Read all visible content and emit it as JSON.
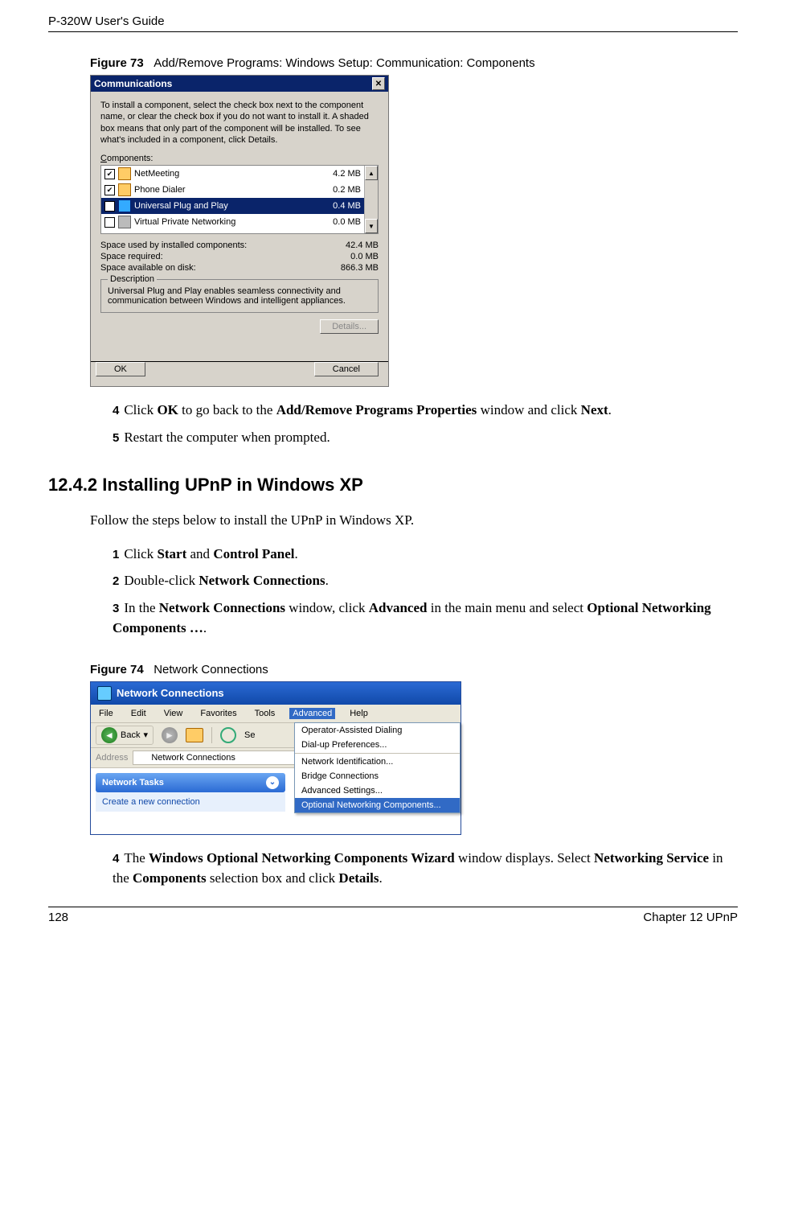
{
  "header": {
    "left": "P-320W User's Guide"
  },
  "figure73": {
    "label": "Figure 73",
    "title": "Add/Remove Programs: Windows Setup: Communication: Components"
  },
  "comm_dialog": {
    "title": "Communications",
    "intro": "To install a component, select the check box next to the component name, or clear the check box if you do not want to install it. A shaded box means that only part of the component will be installed. To see what's included in a component, click Details.",
    "components_label_pre": "C",
    "components_label_post": "omponents:",
    "rows": [
      {
        "checked": true,
        "name": "NetMeeting",
        "size": "4.2 MB",
        "selected": false
      },
      {
        "checked": true,
        "name": "Phone Dialer",
        "size": "0.2 MB",
        "selected": false
      },
      {
        "checked": true,
        "name": "Universal Plug and Play",
        "size": "0.4 MB",
        "selected": true
      },
      {
        "checked": false,
        "name": "Virtual Private Networking",
        "size": "0.0 MB",
        "selected": false
      }
    ],
    "stats": {
      "used_label": "Space used by installed components:",
      "used_val": "42.4 MB",
      "req_label": "Space required:",
      "req_val": "0.0 MB",
      "avail_label": "Space available on disk:",
      "avail_val": "866.3 MB"
    },
    "group_legend": "Description",
    "description": "Universal Plug and Play enables seamless connectivity and communication between Windows and intelligent appliances.",
    "details_btn": "Details...",
    "ok_btn": "OK",
    "cancel_btn": "Cancel"
  },
  "steps_a": {
    "s4_pre": "Click ",
    "s4_b1": "OK",
    "s4_mid": " to go back to the ",
    "s4_b2": "Add/Remove Programs Properties",
    "s4_mid2": " window and click ",
    "s4_b3": "Next",
    "s4_post": ".",
    "s5": "Restart the computer when prompted."
  },
  "section_heading": "12.4.2  Installing UPnP in Windows XP",
  "section_intro": "Follow the steps below to install the UPnP in Windows XP.",
  "steps_b": {
    "s1_pre": "Click ",
    "s1_b1": "Start",
    "s1_mid": " and ",
    "s1_b2": "Control Panel",
    "s1_post": ".",
    "s2_pre": "Double-click ",
    "s2_b1": "Network Connections",
    "s2_post": ".",
    "s3_pre": "In the ",
    "s3_b1": "Network Connections",
    "s3_mid1": " window, click ",
    "s3_b2": "Advanced",
    "s3_mid2": " in the main menu and select ",
    "s3_b3": "Optional Networking Components …",
    "s3_post": "."
  },
  "figure74": {
    "label": "Figure 74",
    "title": "Network Connections"
  },
  "xp": {
    "title": "Network Connections",
    "menus": [
      "File",
      "Edit",
      "View",
      "Favorites",
      "Tools",
      "Advanced",
      "Help"
    ],
    "back_label": "Back",
    "search_label": "Se",
    "dropdown": [
      "Operator-Assisted Dialing",
      "Dial-up Preferences...",
      "Network Identification...",
      "Bridge Connections",
      "Advanced Settings...",
      "Optional Networking Components..."
    ],
    "addr_label": "Address",
    "addr_value": "Network Connections",
    "panel_head": "Network Tasks",
    "panel_item": "Create a new connection"
  },
  "steps_c": {
    "s4_pre": "The ",
    "s4_b1": "Windows Optional Networking Components Wizard",
    "s4_mid1": " window displays. Select ",
    "s4_b2": "Networking Service",
    "s4_mid2": " in the ",
    "s4_b3": "Components",
    "s4_mid3": " selection box and click ",
    "s4_b4": "Details",
    "s4_post": "."
  },
  "footer": {
    "page": "128",
    "chapter": "Chapter 12 UPnP"
  }
}
